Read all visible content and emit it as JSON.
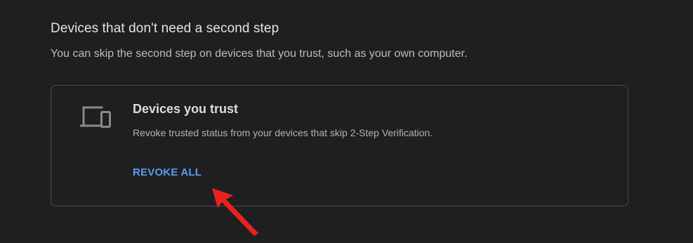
{
  "section": {
    "title": "Devices that don't need a second step",
    "description": "You can skip the second step on devices that you trust, such as your own computer."
  },
  "card": {
    "icon": "devices-icon",
    "title": "Devices you trust",
    "description": "Revoke trusted status from your devices that skip 2-Step Verification.",
    "action_label": "REVOKE ALL"
  },
  "colors": {
    "background": "#1f1f21",
    "accent": "#5a9df2",
    "annotation": "#e8231f"
  }
}
